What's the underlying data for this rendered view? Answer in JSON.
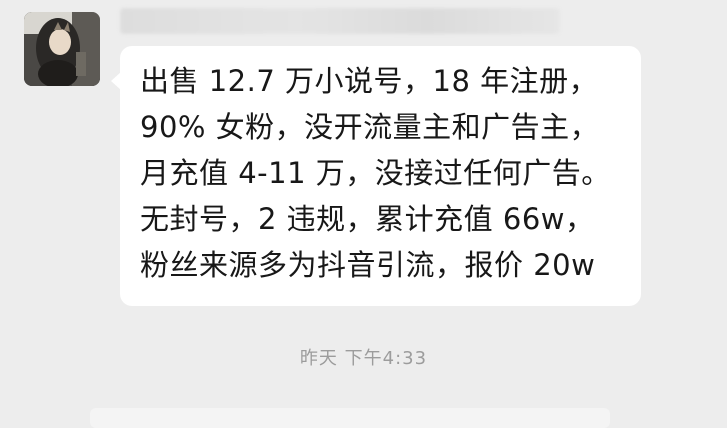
{
  "message": {
    "lines": [
      "出售 12.7 万小说号，18 年注册，",
      "90% 女粉，没开流量主和广告主，",
      "月充值 4-11 万，没接过任何广告。",
      "无封号，2 违规，累计充值 66w，",
      "粉丝来源多为抖音引流，报价 20w"
    ]
  },
  "timestamp": {
    "label": "昨天  下午4:33"
  },
  "colors": {
    "background": "#ededed",
    "bubble": "#ffffff",
    "text": "#181818",
    "timestamp": "#9c9c9c"
  }
}
